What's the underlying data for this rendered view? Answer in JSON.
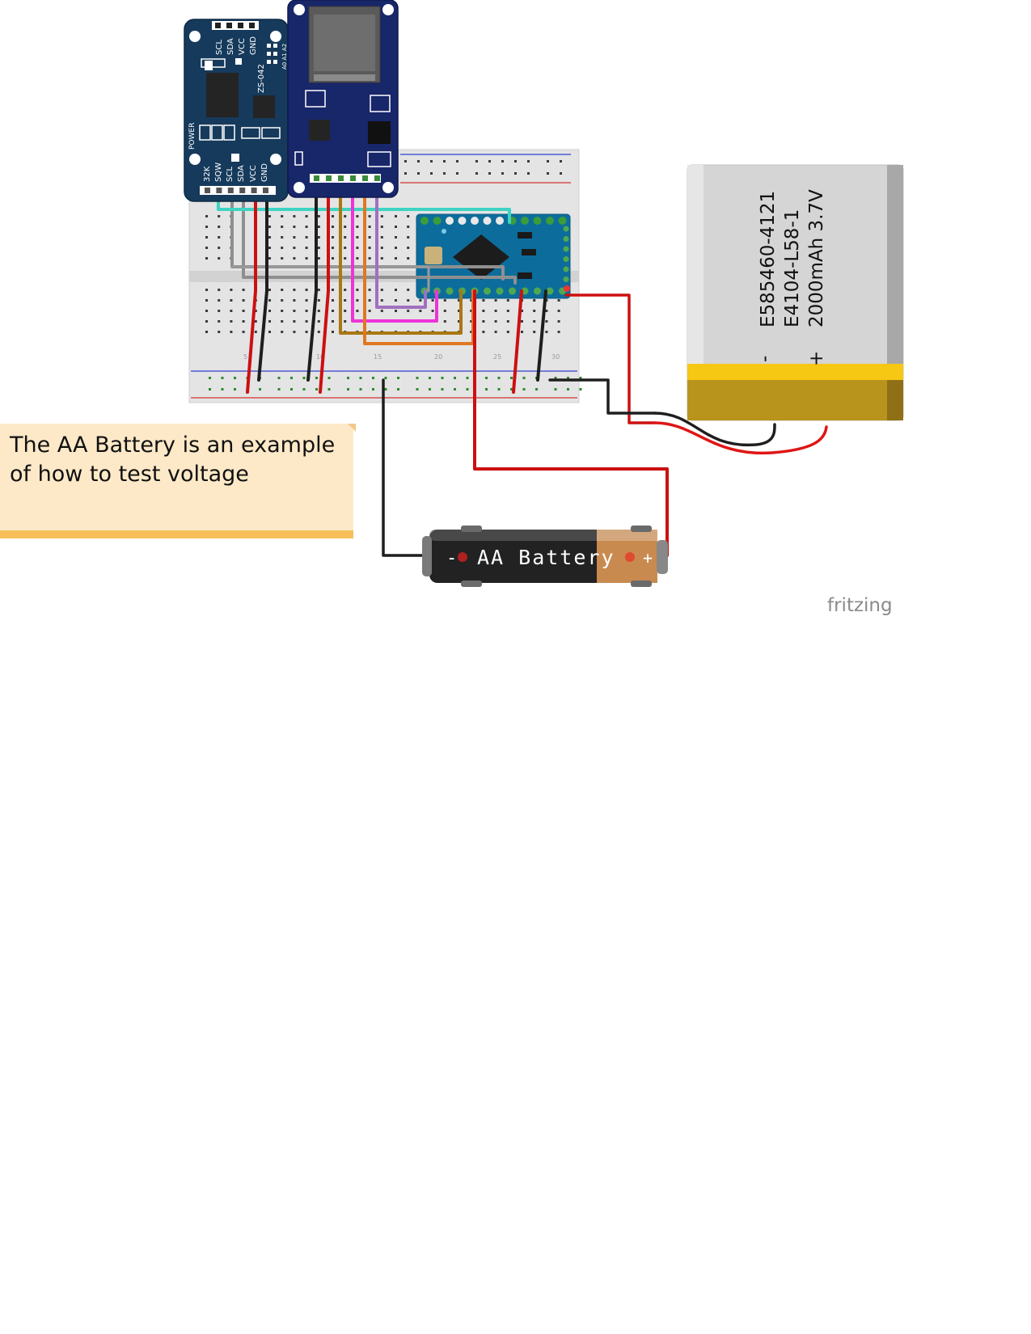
{
  "note": {
    "line1": "The AA Battery is an example",
    "line2": "of how to test voltage"
  },
  "aa_battery": {
    "label": "AA Battery",
    "minus": "-",
    "plus": "+"
  },
  "lipo": {
    "line1": "E585460-4121",
    "line2": "E4104-L58-1",
    "line3": "2000mAh 3.7V",
    "minus": "-",
    "plus": "+"
  },
  "rtc_module": {
    "top_pins": [
      "SCL",
      "SDA",
      "VCC",
      "GND"
    ],
    "bottom_pins": [
      "32K",
      "SQW",
      "SCL",
      "SDA",
      "VCC",
      "GND"
    ],
    "power_label": "POWER",
    "chip_label": "ZS-042",
    "addr_label": "A0 A1 A2"
  },
  "breadboard": {
    "col_labels": [
      "5",
      "10",
      "15",
      "20",
      "25",
      "30"
    ]
  },
  "watermark": "fritzing",
  "colors": {
    "rtc_board": "#163a5c",
    "sd_board": "#18266a",
    "arduino_board": "#0c6d9c",
    "breadboard": "#e3e3e3",
    "lipo_body": "#d5d5d5",
    "lipo_band": "#b8941c",
    "note_bg": "#fde9c8",
    "note_bar": "#f6bf5a",
    "wire_red": "#cc1010",
    "wire_black": "#1e1e1e",
    "wire_gray": "#8a8a8a",
    "wire_cyan": "#3ed3c2",
    "wire_magenta": "#ee33d8",
    "wire_purple": "#a070c0",
    "wire_orange": "#e07722",
    "wire_olive": "#a97814"
  }
}
